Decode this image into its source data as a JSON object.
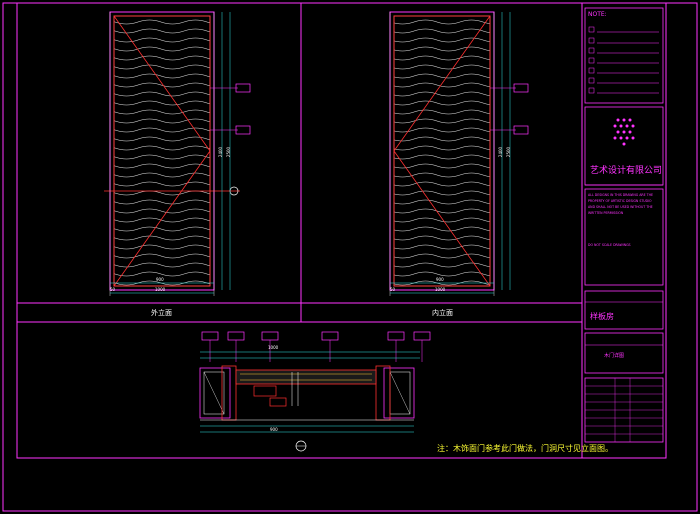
{
  "title_block": {
    "note_label": "NOTE:",
    "company_name": "艺术设计有限公司",
    "english_notes": [
      "ALL DESIGNS IN THIS DRAWING ARE THE",
      "PROPERTY OF ARTISTIC DESIGN STUDIO",
      "AND SHALL NOT BE USED WITHOUT THE",
      "WRITTEN PERMISSION"
    ],
    "scale_note": "DO NOT SCALE DRAWINGS",
    "project_label": "样板房",
    "drawing_name": "木门详图"
  },
  "views": {
    "outer_elevation": "外立面",
    "inner_elevation": "内立面"
  },
  "dimensions": {
    "door_width_inner": "900",
    "door_width_outer": "1000",
    "door_height": "2400",
    "door_height_total": "2500",
    "side_dim": "50",
    "plan_width": "1000"
  },
  "footnote": "注：木饰面门参考此门做法，门洞尺寸见立面图。"
}
